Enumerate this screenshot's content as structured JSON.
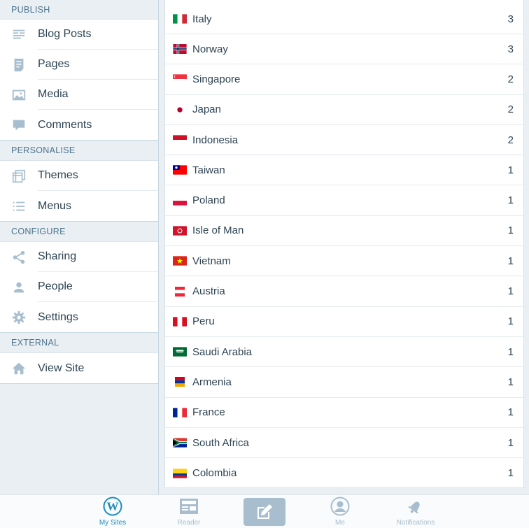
{
  "sidebar": {
    "sections": [
      {
        "header": "PUBLISH",
        "items": [
          {
            "label": "Blog Posts",
            "icon": "posts-icon"
          },
          {
            "label": "Pages",
            "icon": "pages-icon"
          },
          {
            "label": "Media",
            "icon": "media-icon"
          },
          {
            "label": "Comments",
            "icon": "comments-icon"
          }
        ]
      },
      {
        "header": "PERSONALISE",
        "items": [
          {
            "label": "Themes",
            "icon": "themes-icon"
          },
          {
            "label": "Menus",
            "icon": "menus-icon"
          }
        ]
      },
      {
        "header": "CONFIGURE",
        "items": [
          {
            "label": "Sharing",
            "icon": "sharing-icon"
          },
          {
            "label": "People",
            "icon": "people-icon"
          },
          {
            "label": "Settings",
            "icon": "settings-icon"
          }
        ]
      },
      {
        "header": "EXTERNAL",
        "items": [
          {
            "label": "View Site",
            "icon": "house-icon"
          }
        ]
      }
    ]
  },
  "countries": [
    {
      "name": "Italy",
      "count": "3",
      "flag": "italy"
    },
    {
      "name": "Norway",
      "count": "3",
      "flag": "norway"
    },
    {
      "name": "Singapore",
      "count": "2",
      "flag": "singapore"
    },
    {
      "name": "Japan",
      "count": "2",
      "flag": "japan"
    },
    {
      "name": "Indonesia",
      "count": "2",
      "flag": "indonesia"
    },
    {
      "name": "Taiwan",
      "count": "1",
      "flag": "taiwan"
    },
    {
      "name": "Poland",
      "count": "1",
      "flag": "poland"
    },
    {
      "name": "Isle of Man",
      "count": "1",
      "flag": "isle-of-man"
    },
    {
      "name": "Vietnam",
      "count": "1",
      "flag": "vietnam"
    },
    {
      "name": "Austria",
      "count": "1",
      "flag": "austria"
    },
    {
      "name": "Peru",
      "count": "1",
      "flag": "peru"
    },
    {
      "name": "Saudi Arabia",
      "count": "1",
      "flag": "saudi-arabia"
    },
    {
      "name": "Armenia",
      "count": "1",
      "flag": "armenia"
    },
    {
      "name": "France",
      "count": "1",
      "flag": "france"
    },
    {
      "name": "South Africa",
      "count": "1",
      "flag": "south-africa"
    },
    {
      "name": "Colombia",
      "count": "1",
      "flag": "colombia"
    }
  ],
  "tabbar": {
    "tabs": [
      {
        "label": "My Sites",
        "icon": "wordpress-icon",
        "active": true
      },
      {
        "label": "Reader",
        "icon": "reader-icon",
        "active": false
      },
      {
        "label": "Me",
        "icon": "me-icon",
        "active": false
      },
      {
        "label": "Notifications",
        "icon": "bell-icon",
        "active": false
      }
    ],
    "write_icon": "write-icon"
  },
  "colors": {
    "accent": "#1e8cbe",
    "icon_gray": "#87a6bc",
    "tab_inactive": "#a8bece",
    "sidebar_bg": "#e9eff3"
  }
}
